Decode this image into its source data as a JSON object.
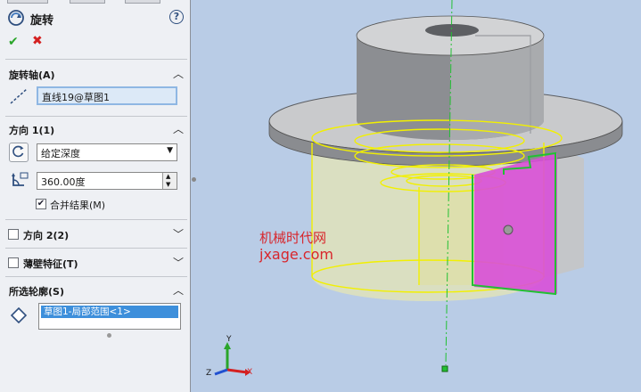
{
  "feature": {
    "title": "旋转",
    "help": "?",
    "ok": "✔",
    "cancel": "✖"
  },
  "rotation_axis": {
    "header": "旋转轴(A)",
    "value": "直线19@草图1"
  },
  "direction1": {
    "header": "方向 1(1)",
    "end_condition": "给定深度",
    "angle": "360.00度",
    "merge_result_label": "合并结果(M)",
    "merge_result_checked": true
  },
  "direction2": {
    "label": "方向 2(2)",
    "checked": false
  },
  "thin_feature": {
    "label": "薄壁特征(T)",
    "checked": false
  },
  "selected_contours": {
    "header": "所选轮廓(S)",
    "items": [
      "草图1-局部范围<1>"
    ]
  },
  "watermark": {
    "line1": "机械时代网",
    "line2": "jxage.com"
  },
  "triad": {
    "x": "X",
    "y": "Y",
    "z": "Z"
  },
  "colors": {
    "panel_bg": "#eef0f4",
    "viewport_bg": "#b9cce6",
    "accept_green": "#2aa52a",
    "cancel_red": "#d42020",
    "selection_blue": "#3d8fdb",
    "preview_yellow": "#f2f000",
    "preview_magenta": "#d84fd8",
    "sketch_green": "#22c033"
  }
}
